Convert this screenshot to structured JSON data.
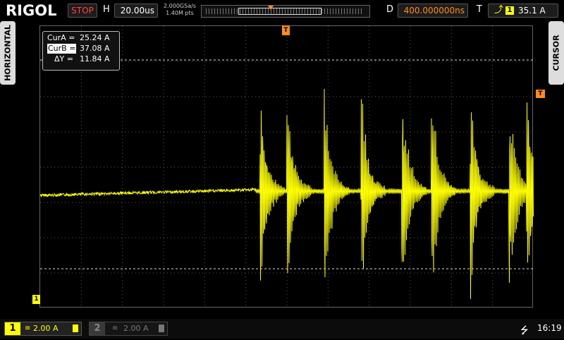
{
  "header": {
    "brand": "RIGOL",
    "run_state": "STOP",
    "h_label": "H",
    "timebase": "20.00us",
    "sample_rate": "2.000GSa/s",
    "mem_depth": "1.40M pts",
    "d_label": "D",
    "delay": "400.000000ns",
    "t_label": "T",
    "trigger_channel": "1",
    "trigger_level": "35.1 A"
  },
  "side_tabs": {
    "left": "HORIZONTAL",
    "right": "CURSOR"
  },
  "cursor_readout": {
    "cur_a_label": "CurA =",
    "cur_a_value": "25.24 A",
    "cur_b_label": "CurB =",
    "cur_b_value": "37.08 A",
    "delta_label": "ΔY =",
    "delta_value": "11.84 A"
  },
  "channels": {
    "ch1": {
      "number": "1",
      "coupling": "≡",
      "scale": "2.00 A"
    },
    "ch2": {
      "number": "2",
      "coupling": "≡",
      "scale": "2.00 A"
    }
  },
  "status": {
    "clock": "16:19"
  },
  "colors": {
    "ch1": "#ffff00",
    "trigger": "#ff8c1a",
    "stop": "#ff4040"
  },
  "markers": {
    "trigger_marker": "T",
    "ch1_ground_marker": "1"
  }
}
